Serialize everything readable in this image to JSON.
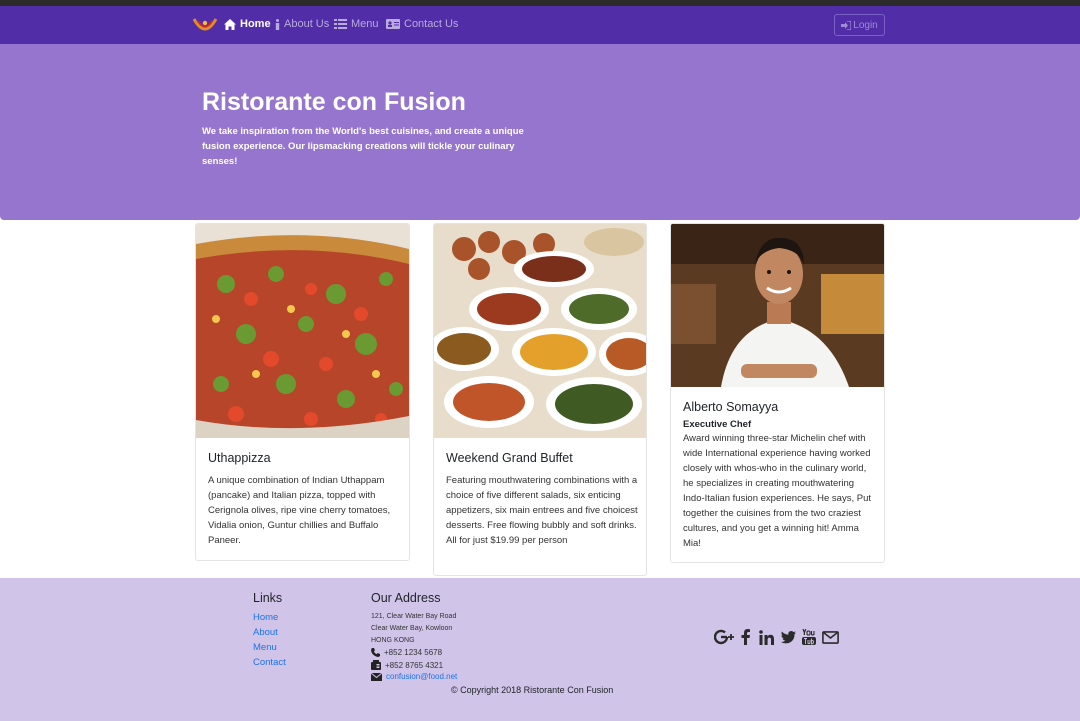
{
  "nav": {
    "items": [
      {
        "label": "Home",
        "icon": "home-icon",
        "active": true
      },
      {
        "label": "About Us",
        "icon": "info-icon"
      },
      {
        "label": "Menu",
        "icon": "list-icon"
      },
      {
        "label": "Contact Us",
        "icon": "address-card-icon"
      }
    ],
    "login_label": "Login"
  },
  "jumbotron": {
    "title": "Ristorante con Fusion",
    "text": "We take inspiration from the World's best cuisines, and create a unique fusion experience. Our lipsmacking creations will tickle your culinary senses!"
  },
  "cards": [
    {
      "title": "Uthappizza",
      "text": "A unique combination of Indian Uthappam (pancake) and Italian pizza, topped with Cerignola olives, ripe vine cherry tomatoes, Vidalia onion, Guntur chillies and Buffalo Paneer."
    },
    {
      "title": "Weekend Grand Buffet",
      "text": "Featuring mouthwatering combinations with a choice of five different salads, six enticing appetizers, six main entrees and five choicest desserts. Free flowing bubbly and soft drinks. All for just $19.99 per person"
    },
    {
      "title": "Alberto Somayya",
      "subtitle": "Executive Chef",
      "text": "Award winning three-star Michelin chef with wide International experience having worked closely with whos-who in the culinary world, he specializes in creating mouthwatering Indo-Italian fusion experiences. He says, Put together the cuisines from the two craziest cultures, and you get a winning hit! Amma Mia!"
    }
  ],
  "footer": {
    "links_heading": "Links",
    "links": [
      "Home",
      "About",
      "Menu",
      "Contact"
    ],
    "address_heading": "Our Address",
    "address_lines": [
      "121, Clear Water Bay Road",
      "Clear Water Bay, Kowloon",
      "HONG KONG"
    ],
    "phone": "+852 1234 5678",
    "fax": "+852 8765 4321",
    "email": "confusion@food.net",
    "social": [
      "google-plus-icon",
      "facebook-icon",
      "linkedin-icon",
      "twitter-icon",
      "youtube-icon",
      "email-icon"
    ],
    "copyright": "© Copyright 2018 Ristorante Con Fusion"
  },
  "colors": {
    "navbar": "#512da8",
    "jumbotron": "#9575cd",
    "footer": "#d1c4e9",
    "link": "#1a73e8"
  }
}
